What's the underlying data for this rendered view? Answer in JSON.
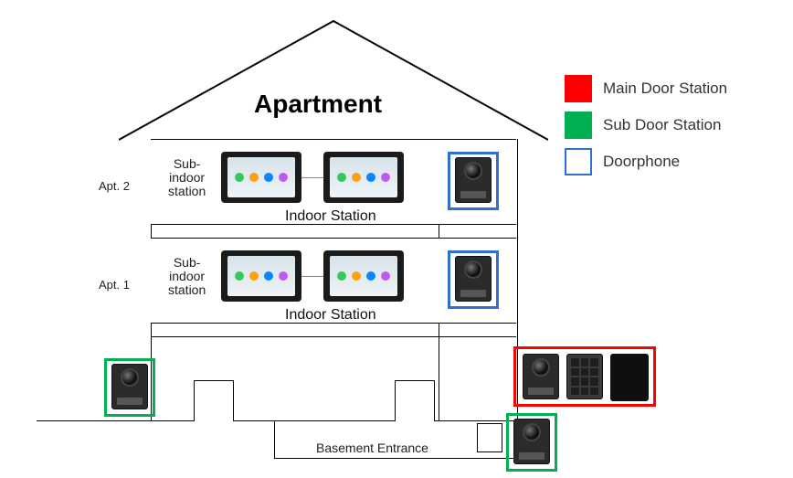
{
  "title": "Apartment",
  "floor_labels": {
    "apt1": "Apt. 1",
    "apt2": "Apt. 2"
  },
  "sub_indoor_label_line1": "Sub-",
  "sub_indoor_label_line2": "indoor",
  "sub_indoor_label_line3": "station",
  "indoor_station_label": "Indoor Station",
  "basement_label": "Basement Entrance",
  "legend": {
    "main": {
      "label": "Main Door Station",
      "color": "#ff0000"
    },
    "sub": {
      "label": "Sub Door Station",
      "color": "#00b050"
    },
    "phone": {
      "label": "Doorphone",
      "color": "#2f6fd0"
    }
  },
  "colors": {
    "red": "#ff0000",
    "green": "#00b050",
    "blue": "#2f6fd0"
  }
}
